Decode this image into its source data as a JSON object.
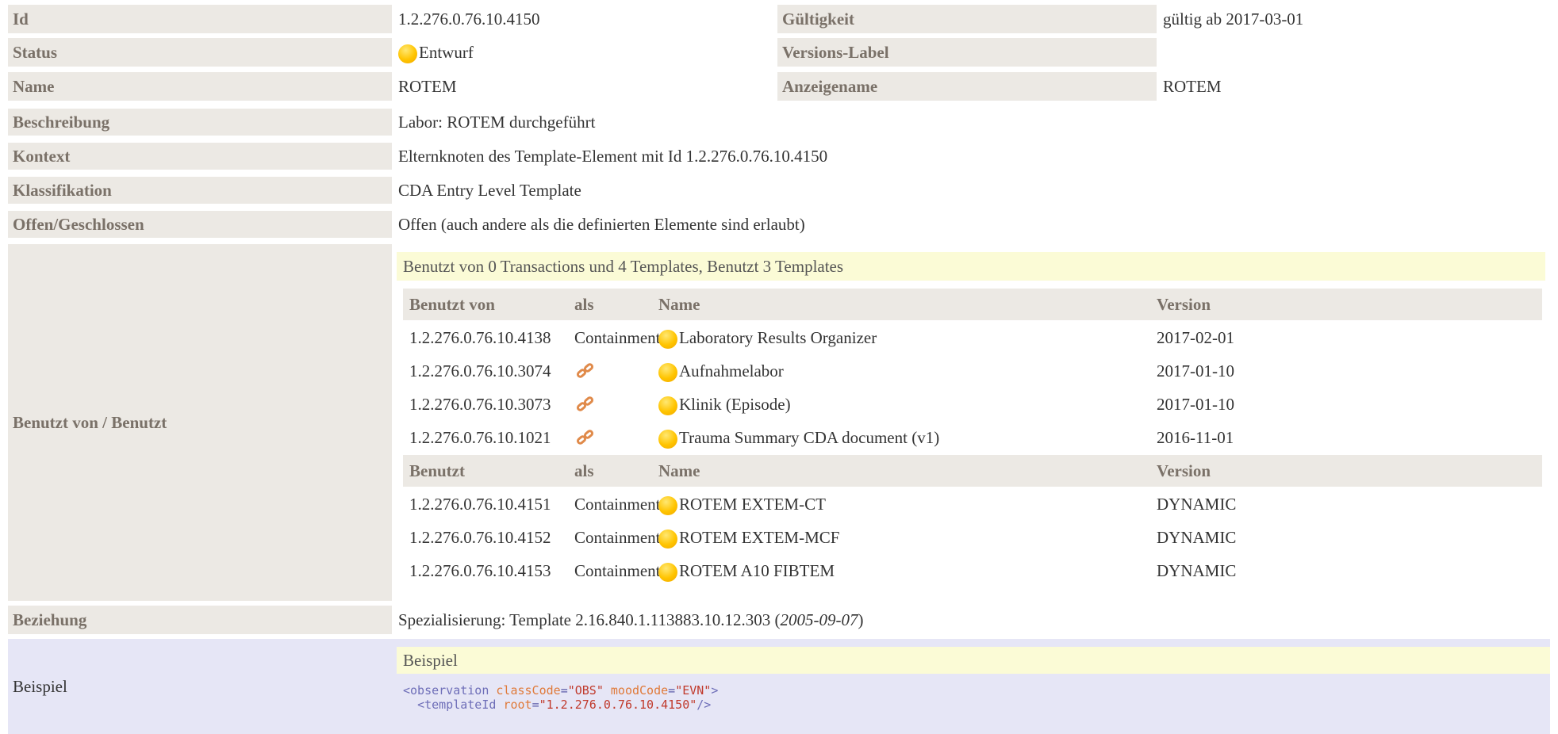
{
  "rows": {
    "id": {
      "label": "Id",
      "value": "1.2.276.0.76.10.4150"
    },
    "gueltigkeit": {
      "label": "Gültigkeit",
      "value": "gültig ab 2017-03-01"
    },
    "status": {
      "label": "Status",
      "value": "Entwurf"
    },
    "versions_label": {
      "label": "Versions-Label",
      "value": ""
    },
    "name": {
      "label": "Name",
      "value": "ROTEM"
    },
    "anzeigename": {
      "label": "Anzeigename",
      "value": "ROTEM"
    },
    "beschreibung": {
      "label": "Beschreibung",
      "value": "Labor: ROTEM durchgeführt"
    },
    "kontext": {
      "label": "Kontext",
      "value": "Elternknoten des Template-Element mit Id 1.2.276.0.76.10.4150"
    },
    "klassifikation": {
      "label": "Klassifikation",
      "value": "CDA Entry Level Template"
    },
    "offen": {
      "label": "Offen/Geschlossen",
      "value": "Offen (auch andere als die definierten Elemente sind erlaubt)"
    },
    "benutzt": {
      "label": "Benutzt von / Benutzt"
    },
    "beziehung": {
      "label": "Beziehung",
      "value_prefix": "Spezialisierung: Template 2.16.840.1.113883.10.12.303 (",
      "value_date": "2005-09-07",
      "value_suffix": ")"
    },
    "beispiel": {
      "label": "Beispiel"
    }
  },
  "usage": {
    "banner": "Benutzt von 0 Transactions und 4 Templates, Benutzt 3 Templates",
    "used_by_header": {
      "col1": "Benutzt von",
      "col2": "als",
      "col3": "Name",
      "col4": "Version"
    },
    "used_by": [
      {
        "id": "1.2.276.0.76.10.4138",
        "als": "Containment",
        "name": "Laboratory Results Organizer",
        "version": "2017-02-01"
      },
      {
        "id": "1.2.276.0.76.10.3074",
        "als": "link",
        "name": "Aufnahmelabor",
        "version": "2017-01-10"
      },
      {
        "id": "1.2.276.0.76.10.3073",
        "als": "link",
        "name": "Klinik (Episode)",
        "version": "2017-01-10"
      },
      {
        "id": "1.2.276.0.76.10.1021",
        "als": "link",
        "name": "Trauma Summary CDA document (v1)",
        "version": "2016-11-01"
      }
    ],
    "uses_header": {
      "col1": "Benutzt",
      "col2": "als",
      "col3": "Name",
      "col4": "Version"
    },
    "uses": [
      {
        "id": "1.2.276.0.76.10.4151",
        "als": "Containment",
        "name": "ROTEM EXTEM-CT",
        "version": "DYNAMIC"
      },
      {
        "id": "1.2.276.0.76.10.4152",
        "als": "Containment",
        "name": "ROTEM EXTEM-MCF",
        "version": "DYNAMIC"
      },
      {
        "id": "1.2.276.0.76.10.4153",
        "als": "Containment",
        "name": "ROTEM A10 FIBTEM",
        "version": "DYNAMIC"
      }
    ]
  },
  "example": {
    "banner": "Beispiel",
    "line1": {
      "tag_open": "<observation",
      "attr1": "classCode",
      "val1": "\"OBS\"",
      "attr2": "moodCode",
      "val2": "\"EVN\"",
      "close": ">"
    },
    "line2": {
      "tag_open": "<templateId",
      "attr1": "root",
      "val1": "\"1.2.276.0.76.10.4150\"",
      "close": "/>"
    }
  },
  "colors": {
    "label_bg": "#ece9e4",
    "banner_bg": "#fbfbd6",
    "example_bg": "#e6e6f6",
    "status_dot": "#ffc400"
  },
  "icons": {
    "status": "status-draft-dot-icon",
    "link": "chain-link-icon"
  }
}
